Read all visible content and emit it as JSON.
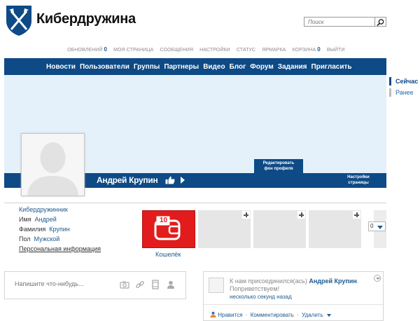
{
  "site": {
    "name": "Кибердружина"
  },
  "search": {
    "placeholder": "Поиск"
  },
  "topnav": {
    "updates": "ОБНОВЛЕНИЙ",
    "updates_count": "0",
    "my_page": "МОЯ СТРАНИЦА",
    "messages": "СООБЩЕНИЯ",
    "settings": "НАСТРОЙКИ",
    "status": "СТАТУС",
    "fair": "ЯРМАРКА",
    "cart": "КОРЗИНА",
    "cart_count": "0",
    "logout": "ВЫЙТИ"
  },
  "mainnav": [
    "Новости",
    "Пользователи",
    "Группы",
    "Партнеры",
    "Видео",
    "Блог",
    "Форум",
    "Задания",
    "Пригласить"
  ],
  "side": {
    "now": "Сейчас",
    "earlier": "Ранее"
  },
  "profile": {
    "name": "Андрей Крупин",
    "edit_cover_1": "Редактировать",
    "edit_cover_2": "фон профиля",
    "page_settings_1": "Настройки",
    "page_settings_2": "страницы"
  },
  "info": {
    "title": "Кибердружинник",
    "first_name_label": "Имя",
    "first_name": "Андрей",
    "last_name_label": "Фамилия",
    "last_name": "Крупин",
    "gender_label": "Пол",
    "gender": "Мужской",
    "personal_info": "Персональная информация"
  },
  "wallet": {
    "label": "Кошелёк",
    "badge": "10"
  },
  "counter": {
    "value": "0"
  },
  "post": {
    "placeholder": "Напишите что-нибудь..."
  },
  "feed": {
    "text_prefix": "К нам присоединился(ась)",
    "name": "Андрей Крупин",
    "text_suffix": ". Поприветствуем!",
    "time": "несколько секунд назад",
    "like": "Нравится",
    "comment": "Комментировать",
    "delete": "Удалить",
    "separator": "·"
  },
  "colors": {
    "brand_blue": "#0d4a86",
    "link_blue": "#1c5a8f",
    "cover_bg": "#e4f1fa",
    "wallet_red": "#e21c1c"
  },
  "icons": [
    "shield-logo-icon",
    "search-icon",
    "like-icon",
    "arrow-right-icon",
    "camera-icon",
    "link-icon",
    "film-icon",
    "person-icon",
    "wallet-icon",
    "plus-icon",
    "dropdown-icon",
    "collapse-icon"
  ]
}
